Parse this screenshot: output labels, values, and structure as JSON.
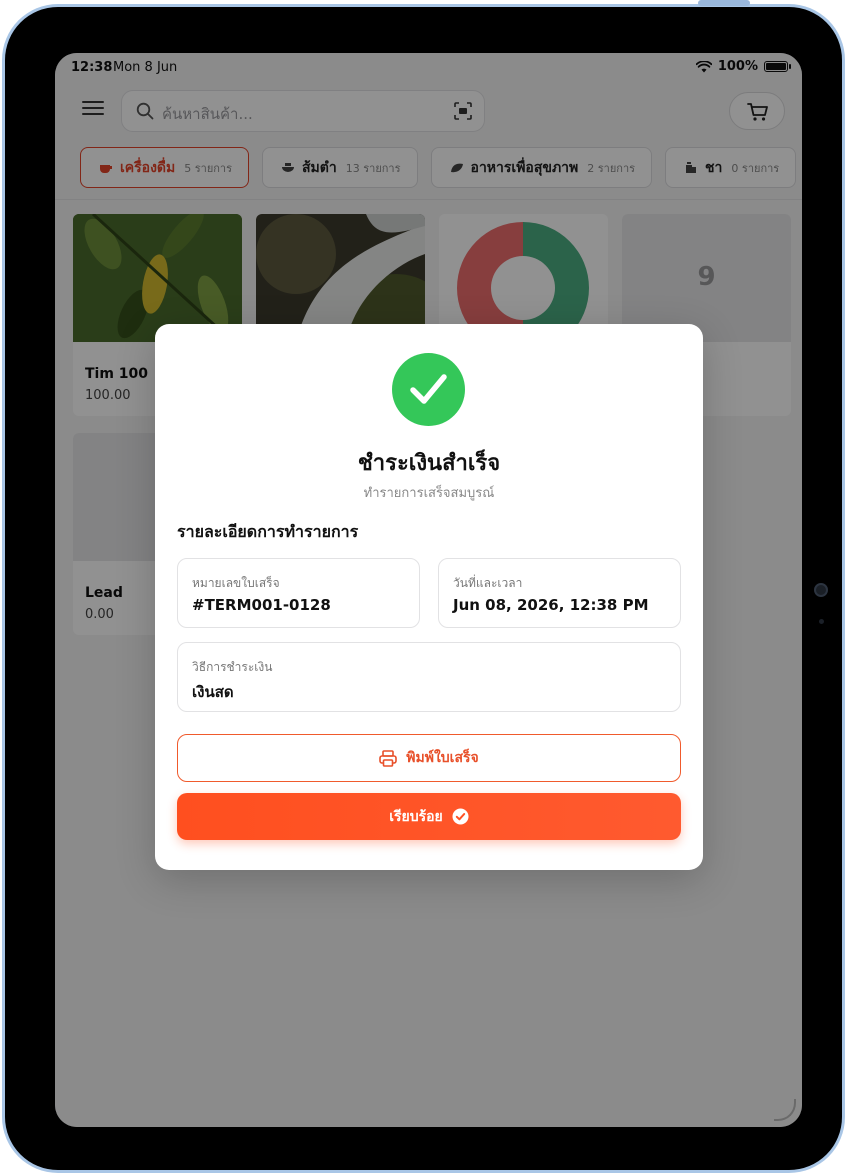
{
  "status": {
    "time": "12:38",
    "date": "Mon 8 Jun",
    "battery": "100%"
  },
  "search": {
    "placeholder": "ค้นหาสินค้า..."
  },
  "categories": [
    {
      "name": "เครื่องดื่ม",
      "count": "5 รายการ",
      "icon": "cup-icon",
      "active": true
    },
    {
      "name": "ส้มตำ",
      "count": "13 รายการ",
      "icon": "bowl-icon",
      "active": false
    },
    {
      "name": "อาหารเพื่อสุขภาพ",
      "count": "2 รายการ",
      "icon": "leaf-icon",
      "active": false
    },
    {
      "name": "ชา",
      "count": "0 รายการ",
      "icon": "tea-icon",
      "active": false
    }
  ],
  "products": [
    {
      "name": "Tim 100",
      "price": "100.00",
      "image": "leaves-photo"
    },
    {
      "name": "",
      "price": "",
      "image": "waterfall-photo"
    },
    {
      "name": "",
      "price": "",
      "image": "donut-graphic"
    },
    {
      "name": "",
      "price": "",
      "placeholder": "9"
    },
    {
      "name": "Lead",
      "price": "0.00",
      "placeholder": ""
    }
  ],
  "modal": {
    "title": "ชำระเงินสำเร็จ",
    "subtitle": "ทำรายการเสร็จสมบูรณ์",
    "section_title": "รายละเอียดการทำรายการ",
    "receipt_label": "หมายเลขใบเสร็จ",
    "receipt_value": "#TERM001-0128",
    "datetime_label": "วันที่และเวลา",
    "datetime_value": "Jun 08, 2026, 12:38 PM",
    "method_label": "วิธีการชำระเงิน",
    "method_value": "เงินสด",
    "print_label": "พิมพ์ใบเสร็จ",
    "done_label": "เรียบร้อย"
  },
  "colors": {
    "accent": "#e5432a",
    "success": "#34c759",
    "primary_button": "#ff5225"
  }
}
